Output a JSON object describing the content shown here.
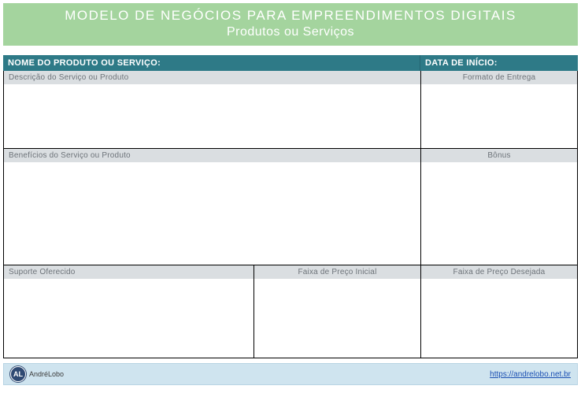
{
  "header": {
    "title": "MODELO DE NEGÓCIOS PARA EMPREENDIMENTOS DIGITAIS",
    "subtitle": "Produtos ou Serviços"
  },
  "labels": {
    "product_name": "NOME DO PRODUTO OU SERVIÇO:",
    "start_date": "DATA DE INÍCIO:"
  },
  "sections": {
    "description": "Descrição do Serviço ou Produto",
    "delivery_format": "Formato de Entrega",
    "benefits": "Benefícios do Serviço ou Produto",
    "bonus": "Bônus",
    "support": "Suporte Oferecido",
    "price_initial": "Faixa de Preço Inicial",
    "price_desired": "Faixa de Preço Desejada"
  },
  "footer": {
    "logo_initials": "AL",
    "logo_name": "AndréLobo",
    "link_text": "https://andrelobo.net.br"
  }
}
